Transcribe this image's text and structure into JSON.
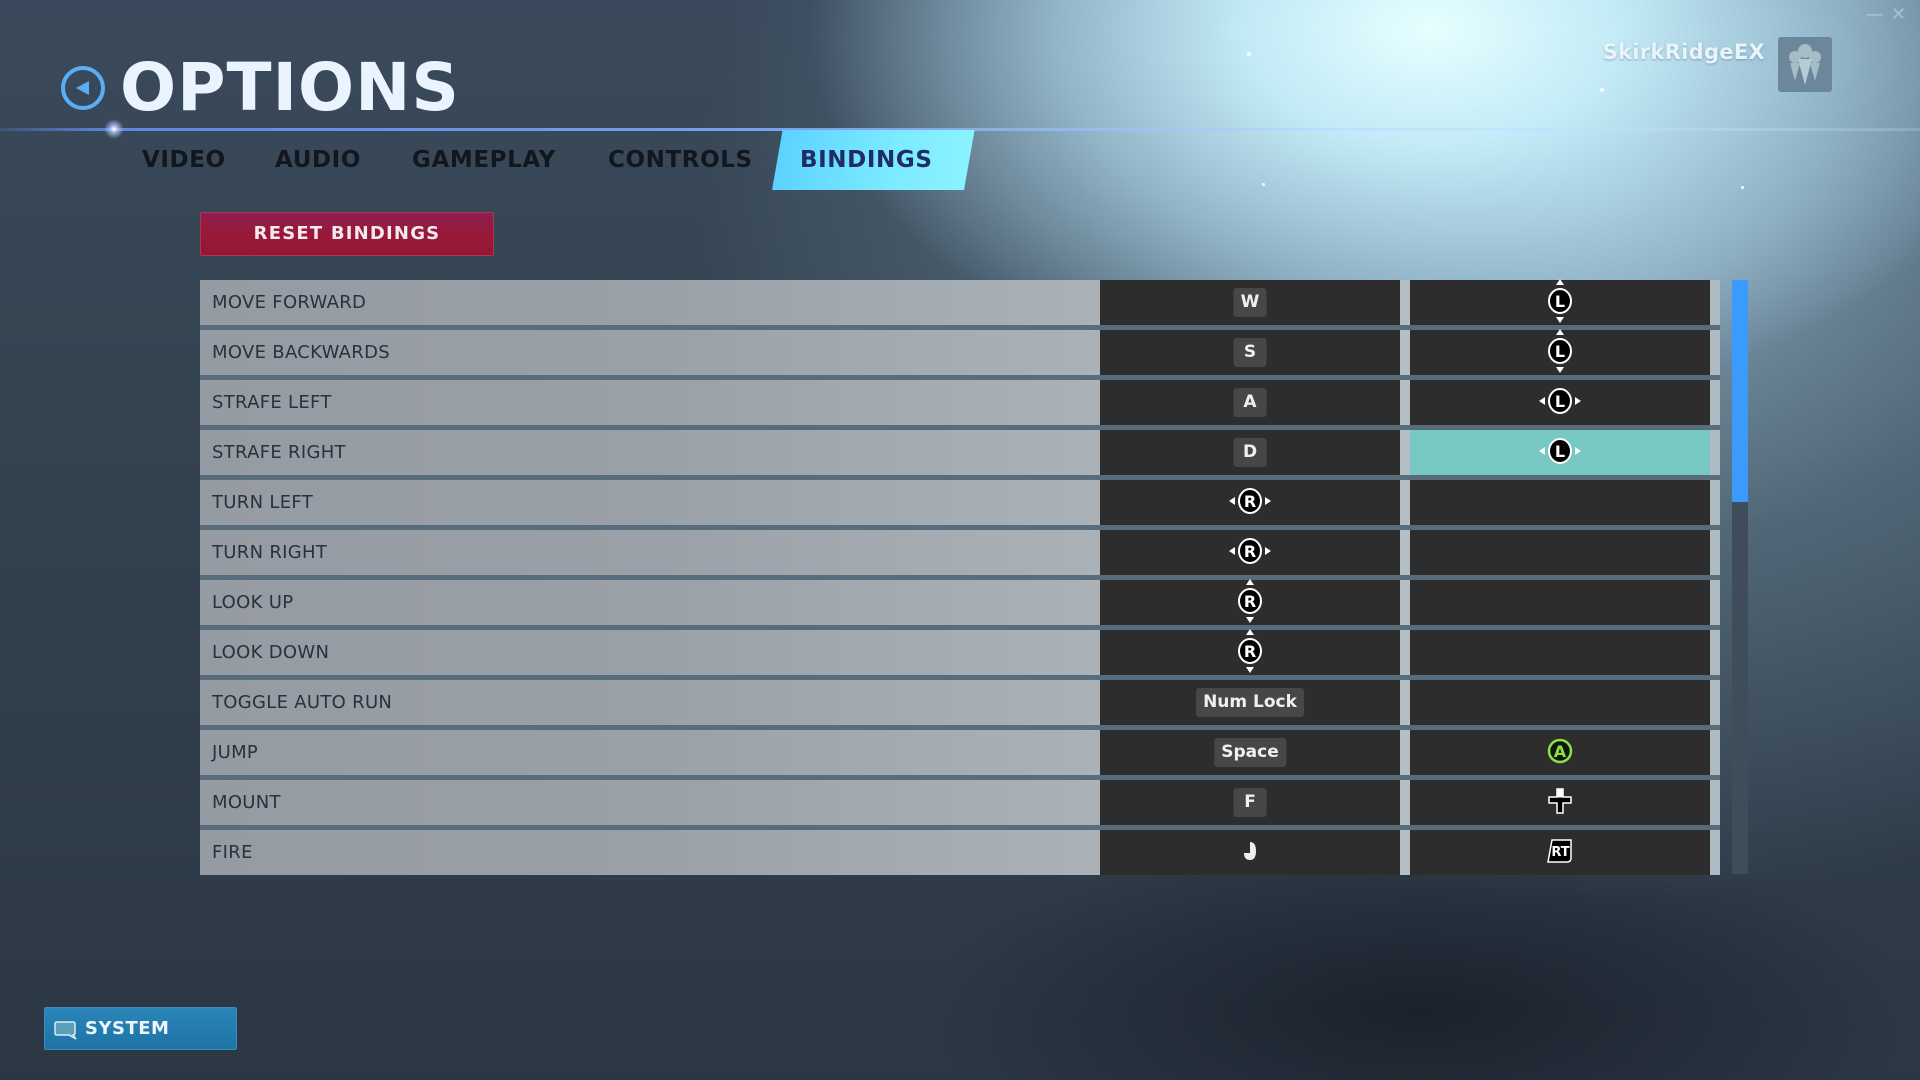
{
  "header": {
    "title": "OPTIONS",
    "username": "SkirkRidgeEX"
  },
  "window_controls": {
    "minimize": "—",
    "close": "✕"
  },
  "tabs": [
    {
      "label": "VIDEO",
      "active": false
    },
    {
      "label": "AUDIO",
      "active": false
    },
    {
      "label": "GAMEPLAY",
      "active": false
    },
    {
      "label": "CONTROLS",
      "active": false
    },
    {
      "label": "BINDINGS",
      "active": true
    }
  ],
  "reset_button": "RESET BINDINGS",
  "bindings": [
    {
      "action": "MOVE FORWARD",
      "primary": {
        "type": "key",
        "value": "W"
      },
      "secondary": {
        "type": "icon",
        "value": "left-stick-up-icon"
      }
    },
    {
      "action": "MOVE BACKWARDS",
      "primary": {
        "type": "key",
        "value": "S"
      },
      "secondary": {
        "type": "icon",
        "value": "left-stick-down-icon"
      }
    },
    {
      "action": "STRAFE LEFT",
      "primary": {
        "type": "key",
        "value": "A"
      },
      "secondary": {
        "type": "icon",
        "value": "left-stick-horizontal-icon"
      }
    },
    {
      "action": "STRAFE RIGHT",
      "primary": {
        "type": "key",
        "value": "D"
      },
      "secondary": {
        "type": "icon",
        "value": "left-stick-horizontal-icon",
        "selected": true
      }
    },
    {
      "action": "TURN LEFT",
      "primary": {
        "type": "icon",
        "value": "right-stick-horizontal-icon"
      },
      "secondary": null
    },
    {
      "action": "TURN RIGHT",
      "primary": {
        "type": "icon",
        "value": "right-stick-horizontal-icon"
      },
      "secondary": null
    },
    {
      "action": "LOOK UP",
      "primary": {
        "type": "icon",
        "value": "right-stick-vertical-icon"
      },
      "secondary": null
    },
    {
      "action": "LOOK DOWN",
      "primary": {
        "type": "icon",
        "value": "right-stick-vertical-icon"
      },
      "secondary": null
    },
    {
      "action": "TOGGLE AUTO RUN",
      "primary": {
        "type": "key",
        "value": "Num Lock"
      },
      "secondary": null
    },
    {
      "action": "JUMP",
      "primary": {
        "type": "key",
        "value": "Space"
      },
      "secondary": {
        "type": "icon",
        "value": "a-button-icon"
      }
    },
    {
      "action": "MOUNT",
      "primary": {
        "type": "key",
        "value": "F"
      },
      "secondary": {
        "type": "icon",
        "value": "dpad-up-icon"
      }
    },
    {
      "action": "FIRE",
      "primary": {
        "type": "icon",
        "value": "left-mouse-button-icon"
      },
      "secondary": {
        "type": "icon",
        "value": "rt-trigger-icon"
      }
    }
  ],
  "glyph_letters": {
    "left_stick": "L",
    "right_stick": "R",
    "a_button": "A",
    "rt_trigger": "RT"
  },
  "scrollbar": {
    "visible_fraction": 0.37,
    "position": 0.0
  },
  "system_button": "SYSTEM",
  "colors": {
    "accent_tab": "#7ceaff",
    "reset_button": "#9a1838",
    "selected_cell": "#77c7c3",
    "scrollbar_thumb": "#3a9bfd",
    "a_button_green": "#8ee04a",
    "system_button": "#2a85b8"
  }
}
